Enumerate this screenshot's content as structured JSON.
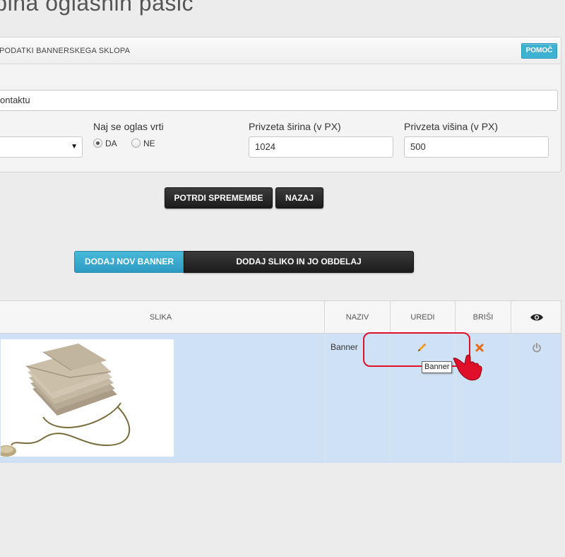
{
  "page": {
    "title": "upina oglasnih pasic"
  },
  "panel": {
    "title": "PODATKI BANNERSKEGA SKLOPA",
    "help_label": "POMOČ",
    "name_value": "ontaktu",
    "rotate": {
      "label": "Naj se oglas vrti",
      "yes": "DA",
      "no": "NE",
      "selected": "DA"
    },
    "width": {
      "label": "Privzeta širina (v PX)",
      "value": "1024"
    },
    "height": {
      "label": "Privzeta višina (v PX)",
      "value": "500"
    },
    "select_value": ""
  },
  "actions": {
    "confirm_label": "POTRDI SPREMEMBE",
    "back_label": "NAZAJ",
    "add_banner_label": "DODAJ NOV BANNER",
    "add_image_label": "DODAJ SLIKO IN JO OBDELAJ"
  },
  "table": {
    "headers": {
      "image": "SLIKA",
      "name": "NAZIV",
      "edit": "UREDI",
      "delete": "BRIŠI"
    },
    "rows": [
      {
        "name": "Banner"
      }
    ]
  },
  "tooltip": {
    "text": "Banner"
  },
  "icons": {
    "visibility": "eye-icon",
    "edit": "pencil-icon",
    "delete": "x-icon",
    "power": "power-icon"
  },
  "colors": {
    "accent_blue": "#3fb1d3",
    "row_highlight": "#cfe2f5",
    "delete_orange": "#e36b1a",
    "edit_orange": "#f0a020",
    "highlight_red": "#e0102a"
  }
}
